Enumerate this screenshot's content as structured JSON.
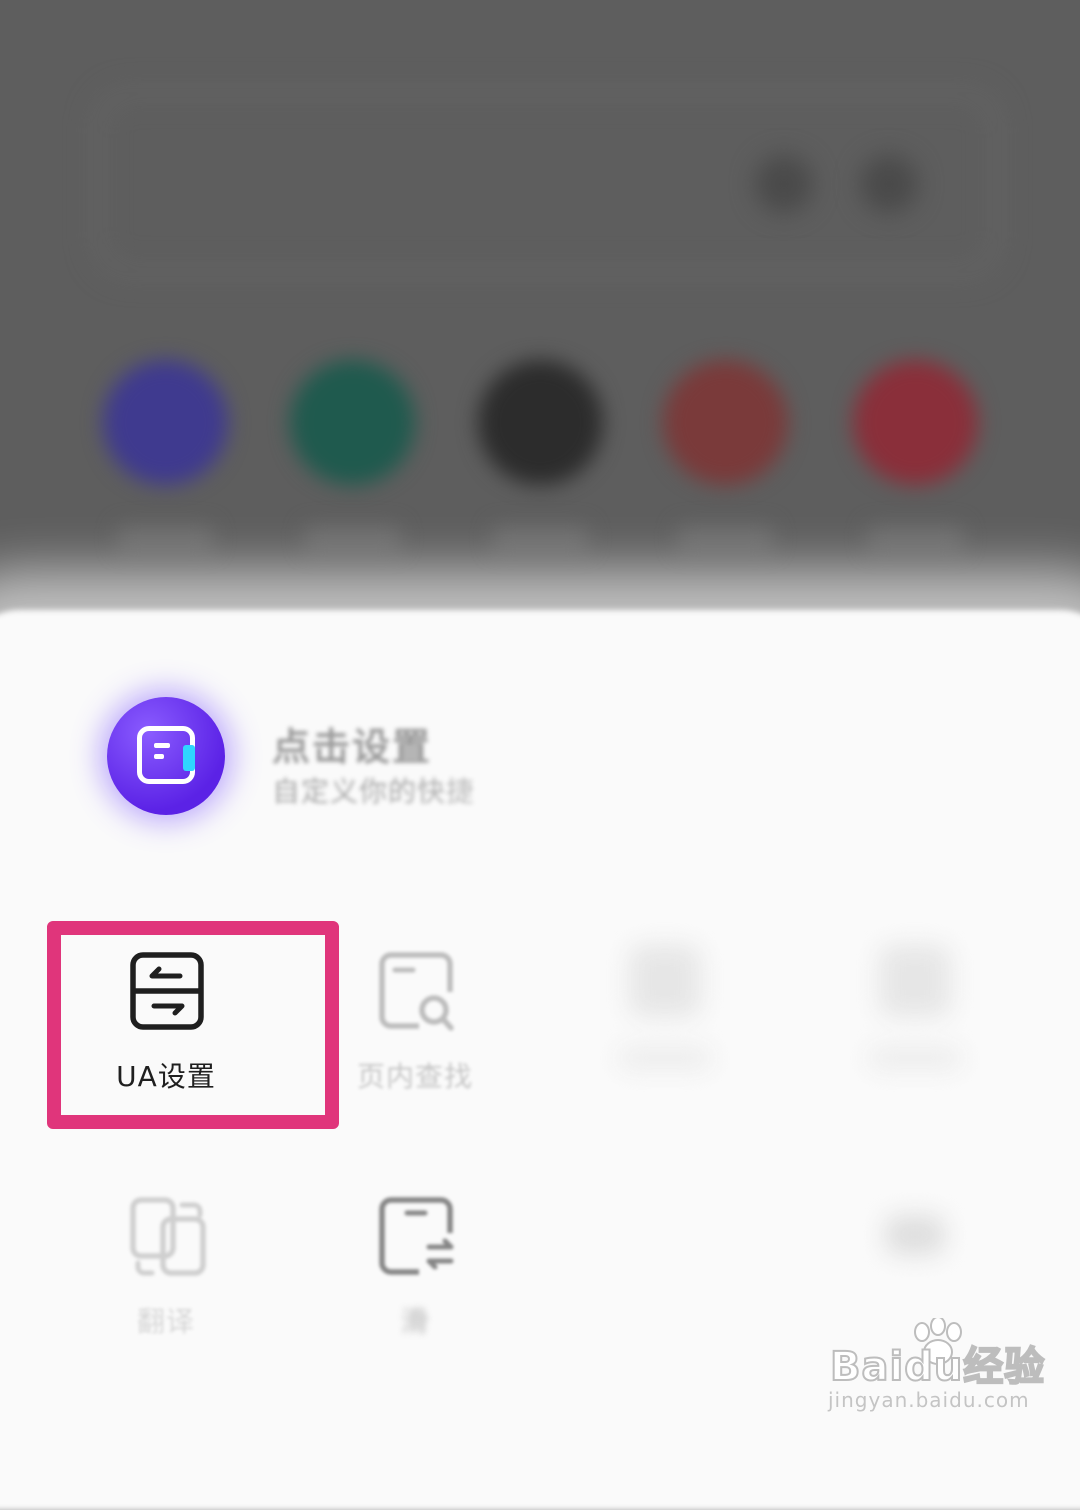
{
  "header": {
    "title": "点击设置",
    "subtitle": "自定义你的快捷"
  },
  "tools": [
    {
      "label": "UA设置",
      "icon": "ua-switch-icon",
      "highlighted": true
    },
    {
      "label": "页内查找",
      "icon": "find-in-page-icon"
    },
    {
      "label": "翻译",
      "icon": "translate-icon"
    },
    {
      "label": "滑",
      "icon": "swipe-switch-icon"
    }
  ],
  "highlight_color": "#e0357b",
  "accent_color": "#5b22e6",
  "watermark": {
    "main": "Baidu经验",
    "sub": "jingyan.baidu.com"
  }
}
